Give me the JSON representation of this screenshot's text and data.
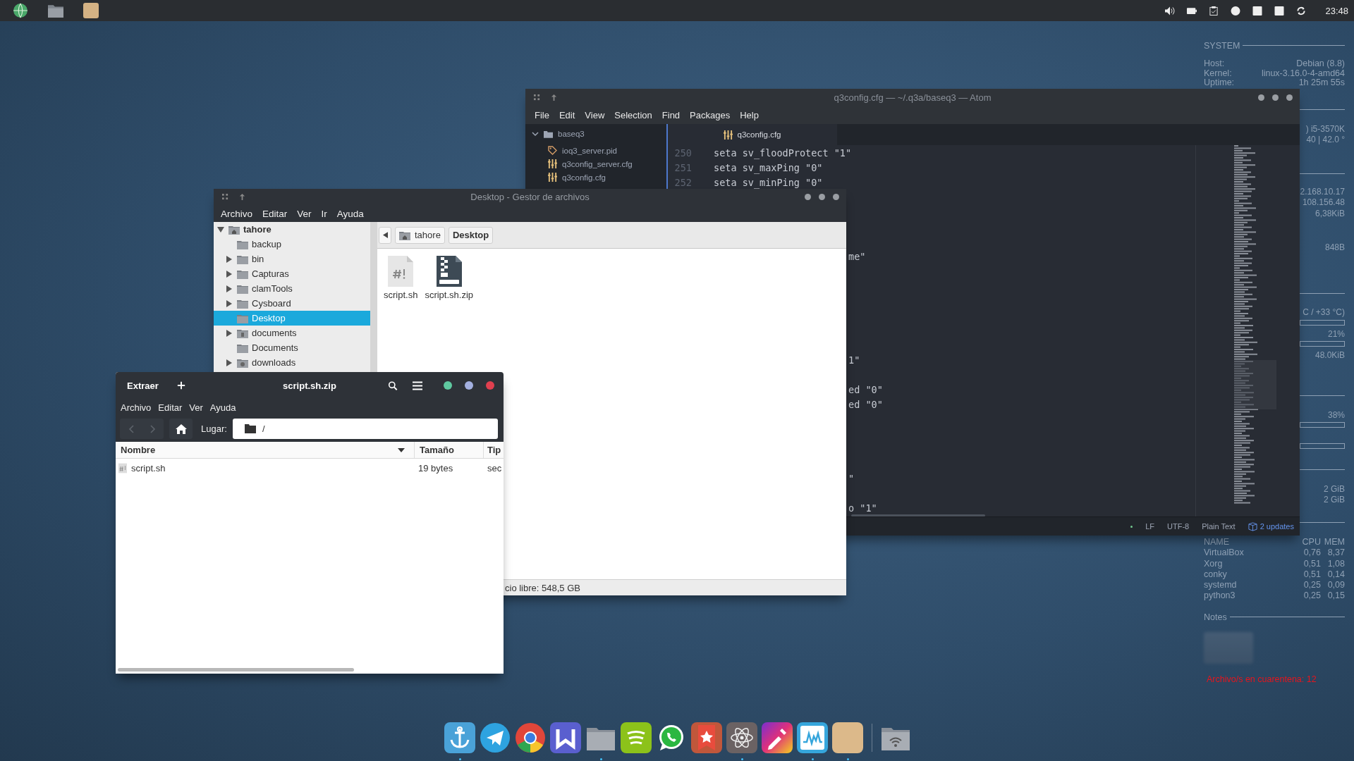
{
  "top_bar": {
    "launchers": [
      {
        "kind": "globe"
      },
      {
        "kind": "folder"
      },
      {
        "kind": "square"
      }
    ],
    "tray": [
      {
        "kind": "volume"
      },
      {
        "kind": "battery"
      },
      {
        "kind": "clipboard"
      },
      {
        "kind": "circle"
      },
      {
        "kind": "square"
      },
      {
        "kind": "square"
      },
      {
        "kind": "sync"
      }
    ],
    "clock": "23:48"
  },
  "conky": {
    "system_heading": "SYSTEM",
    "system_rows": [
      {
        "label": "Host:",
        "value": "Debian (8.8)"
      },
      {
        "label": "Kernel:",
        "value": "linux-3.16.0-4-amd64"
      },
      {
        "label": "Uptime:",
        "value": "1h 25m 55s"
      }
    ],
    "readings": [
      ") i5-3570K",
      "40 | 42.0 °",
      "2.168.10.17",
      "108.156.48",
      "6,38KiB",
      "848B",
      "C /  +33 °C)",
      "21%",
      "48.0KiB",
      "38%",
      "2 GiB",
      "2 GiB"
    ],
    "process_columns": [
      "NAME",
      "CPU",
      "MEM"
    ],
    "processes": [
      {
        "name": "VirtualBox",
        "cpu": "0,76",
        "mem": "8,37"
      },
      {
        "name": "Xorg",
        "cpu": "0,51",
        "mem": "1,08"
      },
      {
        "name": "conky",
        "cpu": "0,51",
        "mem": "0,14"
      },
      {
        "name": "systemd",
        "cpu": "0,25",
        "mem": "0,09"
      },
      {
        "name": "python3",
        "cpu": "0,25",
        "mem": "0,15"
      }
    ],
    "notes_heading": "Notes",
    "alert": "Archivo/s en cuarentena: 12"
  },
  "atom": {
    "title": "q3config.cfg — ~/.q3a/baseq3 — Atom",
    "menu": [
      "File",
      "Edit",
      "View",
      "Selection",
      "Find",
      "Packages",
      "Help"
    ],
    "tree": {
      "name": "baseq3",
      "expanded": true,
      "children": [
        {
          "name": "ioq3_server.pid",
          "kind": "tag"
        },
        {
          "name": "q3config_server.cfg",
          "kind": "config"
        },
        {
          "name": "q3config.cfg",
          "kind": "config"
        }
      ]
    },
    "tabs": [
      {
        "label": "q3config.cfg",
        "selected": true
      }
    ],
    "lines": [
      {
        "number": "250",
        "code": "seta sv_floodProtect \"1\""
      },
      {
        "number": "251",
        "code": "seta sv_maxPing \"0\""
      },
      {
        "number": "252",
        "code": "seta sv_minPing \"0\""
      },
      {
        "code": "me\""
      },
      {
        "code": "1\""
      },
      {
        "code": "ed \"0\""
      },
      {
        "code": "ed \"0\""
      },
      {
        "code": "\""
      },
      {
        "code": "o \"1\""
      }
    ],
    "status": {
      "line_ending": "LF",
      "encoding": "UTF-8",
      "grammar": "Plain Text",
      "updates": "2 updates"
    }
  },
  "file_manager": {
    "title": "Desktop - Gestor de archivos",
    "menu": [
      "Archivo",
      "Editar",
      "Ver",
      "Ir",
      "Ayuda"
    ],
    "tree": {
      "name": "tahore",
      "kind": "home",
      "has_children": true,
      "expanded": true,
      "selected": false,
      "children": [
        {
          "name": "backup",
          "kind": "folder",
          "has_children": false,
          "expanded": false,
          "selected": false
        },
        {
          "name": "bin",
          "kind": "folder",
          "has_children": true,
          "expanded": false,
          "selected": false
        },
        {
          "name": "Capturas",
          "kind": "folder",
          "has_children": true,
          "expanded": false,
          "selected": false
        },
        {
          "name": "clamTools",
          "kind": "folder",
          "has_children": true,
          "expanded": false,
          "selected": false
        },
        {
          "name": "Cysboard",
          "kind": "folder",
          "has_children": true,
          "expanded": false,
          "selected": false
        },
        {
          "name": "Desktop",
          "kind": "folder",
          "has_children": false,
          "expanded": false,
          "selected": true
        },
        {
          "name": "documents",
          "kind": "documents",
          "has_children": true,
          "expanded": false,
          "selected": false
        },
        {
          "name": "Documents",
          "kind": "folder",
          "has_children": false,
          "expanded": false,
          "selected": false
        },
        {
          "name": "downloads",
          "kind": "downloads",
          "has_children": true,
          "expanded": false,
          "selected": false
        }
      ]
    },
    "path": [
      {
        "label": "tahore",
        "kind": "home",
        "selected": false
      },
      {
        "label": "Desktop",
        "kind": "plain",
        "selected": true
      }
    ],
    "files": [
      {
        "name": "script.sh",
        "kind": "script"
      },
      {
        "name": "script.sh.zip",
        "kind": "zip"
      }
    ],
    "status": "cio libre: 548,5 GB"
  },
  "archive_manager": {
    "title": "script.sh.zip",
    "extract_button": "Extraer",
    "menu": [
      "Archivo",
      "Editar",
      "Ver",
      "Ayuda"
    ],
    "nav": [
      {
        "kind": "back",
        "disabled": true
      },
      {
        "kind": "forward",
        "disabled": true
      }
    ],
    "location_label": "Lugar:",
    "location": "/",
    "columns": [
      {
        "label": "Nombre",
        "sorted": true
      },
      {
        "label": "Tamaño",
        "sorted": false
      },
      {
        "label": "Tip",
        "sorted": false
      }
    ],
    "rows": [
      {
        "name": "script.sh",
        "size": "19 bytes",
        "type": "sec"
      }
    ]
  },
  "dock": [
    {
      "kind": "anchor",
      "running": true
    },
    {
      "kind": "telegram",
      "running": false
    },
    {
      "kind": "chrome",
      "running": false
    },
    {
      "kind": "zigzag",
      "running": false
    },
    {
      "kind": "folder",
      "running": true
    },
    {
      "kind": "spotify",
      "running": false
    },
    {
      "kind": "whatsapp",
      "running": false
    },
    {
      "kind": "star",
      "running": false
    },
    {
      "kind": "atom",
      "running": true
    },
    {
      "kind": "dropper",
      "running": false
    },
    {
      "kind": "monitor",
      "running": true
    },
    {
      "kind": "tan",
      "running": true
    },
    {
      "kind": "separator",
      "running": false
    },
    {
      "kind": "netfolder",
      "running": false
    }
  ]
}
